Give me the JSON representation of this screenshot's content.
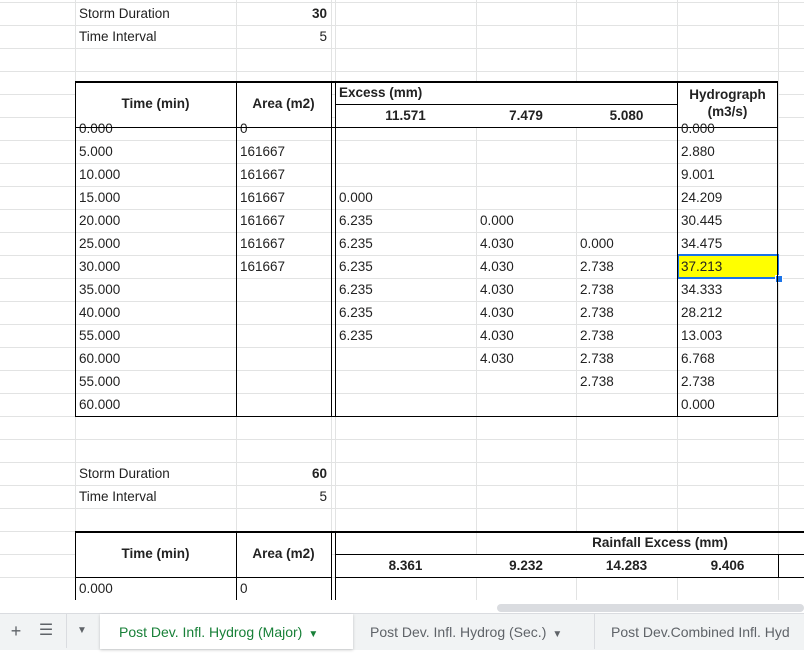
{
  "block1": {
    "storm_duration_label": "Storm Duration",
    "storm_duration_value": "30",
    "time_interval_label": "Time Interval",
    "time_interval_value": "5",
    "headers": {
      "time": "Time (min)",
      "area": "Area (m2)",
      "excess": "Excess (mm)",
      "excess_values": [
        "11.571",
        "7.479",
        "5.080"
      ],
      "hydrograph": "Hydrograph",
      "hydrograph_unit": "(m3/s)"
    },
    "rows": [
      {
        "time": "0.000",
        "area": "0",
        "e1": "",
        "e2": "",
        "e3": "",
        "h": "0.000"
      },
      {
        "time": "5.000",
        "area": "161667",
        "e1": "",
        "e2": "",
        "e3": "",
        "h": "2.880"
      },
      {
        "time": "10.000",
        "area": "161667",
        "e1": "",
        "e2": "",
        "e3": "",
        "h": "9.001"
      },
      {
        "time": "15.000",
        "area": "161667",
        "e1": "0.000",
        "e2": "",
        "e3": "",
        "h": "24.209"
      },
      {
        "time": "20.000",
        "area": "161667",
        "e1": "6.235",
        "e2": "0.000",
        "e3": "",
        "h": "30.445"
      },
      {
        "time": "25.000",
        "area": "161667",
        "e1": "6.235",
        "e2": "4.030",
        "e3": "0.000",
        "h": "34.475"
      },
      {
        "time": "30.000",
        "area": "161667",
        "e1": "6.235",
        "e2": "4.030",
        "e3": "2.738",
        "h": "37.213"
      },
      {
        "time": "35.000",
        "area": "",
        "e1": "6.235",
        "e2": "4.030",
        "e3": "2.738",
        "h": "34.333"
      },
      {
        "time": "40.000",
        "area": "",
        "e1": "6.235",
        "e2": "4.030",
        "e3": "2.738",
        "h": "28.212"
      },
      {
        "time": "55.000",
        "area": "",
        "e1": "6.235",
        "e2": "4.030",
        "e3": "2.738",
        "h": "13.003"
      },
      {
        "time": "60.000",
        "area": "",
        "e1": "",
        "e2": "4.030",
        "e3": "2.738",
        "h": "6.768"
      },
      {
        "time": "55.000",
        "area": "",
        "e1": "",
        "e2": "",
        "e3": "2.738",
        "h": "2.738"
      },
      {
        "time": "60.000",
        "area": "",
        "e1": "",
        "e2": "",
        "e3": "",
        "h": "0.000"
      }
    ]
  },
  "block2": {
    "storm_duration_label": "Storm Duration",
    "storm_duration_value": "60",
    "time_interval_label": "Time Interval",
    "time_interval_value": "5",
    "headers": {
      "time": "Time (min)",
      "area": "Area (m2)",
      "rainfall_excess": "Rainfall Excess (mm)",
      "excess_values": [
        "8.361",
        "9.232",
        "14.283",
        "9.406"
      ]
    },
    "rows": [
      {
        "time": "0.000",
        "area": "0"
      }
    ]
  },
  "selected_cell_color": "#ffff00",
  "accent_color": "#1a73e8",
  "active_tab_color": "#188038",
  "tabbar": {
    "add_sheet_icon": "plus-icon",
    "all_sheets_icon": "list-icon",
    "tabs": [
      {
        "label": "Post Dev. Infl. Hydrog (Major)",
        "active": true
      },
      {
        "label": "Post Dev. Infl. Hydrog (Sec.)",
        "active": false
      },
      {
        "label": "Post Dev.Combined Infl. Hyd",
        "active": false
      }
    ]
  }
}
